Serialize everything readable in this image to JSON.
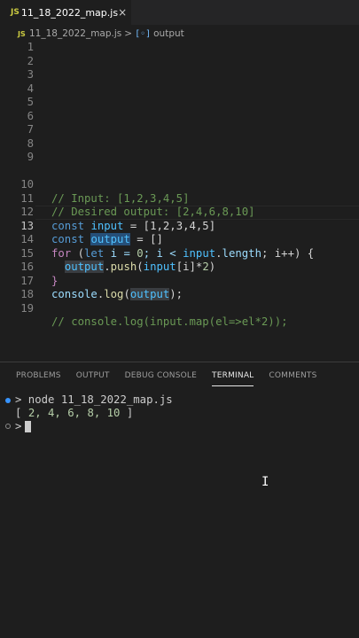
{
  "tab": {
    "icon": "JS",
    "filename": "11_18_2022_map.js",
    "close": "×"
  },
  "breadcrumb": {
    "icon": "JS",
    "file": "11_18_2022_map.js",
    "separator": ">",
    "symbol_icon": "[◦]",
    "symbol": "output"
  },
  "editor": {
    "line_numbers": [
      "1",
      "2",
      "3",
      "4",
      "5",
      "6",
      "7",
      "8",
      "9",
      "10",
      "11",
      "12",
      "13",
      "14",
      "15",
      "16",
      "17",
      "18",
      "19"
    ],
    "active_line": 13,
    "lines": {
      "l10": "// Input: [1,2,3,4,5]",
      "l11": "// Desired output: [2,4,6,8,10]",
      "l12": {
        "kw": "const",
        "name": "input",
        "rest": " = [1,2,3,4,5]"
      },
      "l13": {
        "kw": "const",
        "name": "output",
        "rest": " = []"
      },
      "l14": {
        "kw": "for",
        "p1": " (",
        "let": "let",
        "p2": " i = ",
        "zero": "0",
        "p3": "; i < ",
        "input": "input",
        "dot": ".",
        "length": "length",
        "p4": "; i++) {"
      },
      "l15": {
        "indent": "  ",
        "output": "output",
        "dot": ".",
        "push": "push",
        "p1": "(",
        "input": "input",
        "p2": "[i]*",
        "two": "2",
        "p3": ")"
      },
      "l16": "}",
      "l17": {
        "console": "console",
        "dot": ".",
        "log": "log",
        "p1": "(",
        "output": "output",
        "p2": ");"
      },
      "l19": "// console.log(input.map(el=>el*2));"
    }
  },
  "panel": {
    "tabs": [
      "PROBLEMS",
      "OUTPUT",
      "DEBUG CONSOLE",
      "TERMINAL",
      "COMMENTS"
    ],
    "active_tab": "TERMINAL"
  },
  "terminal": {
    "line1": "> node 11_18_2022_map.js",
    "line2_open": "[ ",
    "line2_values": "2, 4, 6, 8, 10",
    "line2_close": " ]",
    "prompt": ">"
  },
  "colors": {
    "background": "#1e1e1e",
    "comment": "#6a9955",
    "keyword": "#569cd6",
    "number": "#b5cea8",
    "variable": "#9cdcfe",
    "function": "#dcdcaa"
  },
  "icons": {
    "tab_file": "javascript-file-icon",
    "breadcrumb_symbol": "variable-symbol-icon",
    "mouse": "text-cursor-icon"
  }
}
